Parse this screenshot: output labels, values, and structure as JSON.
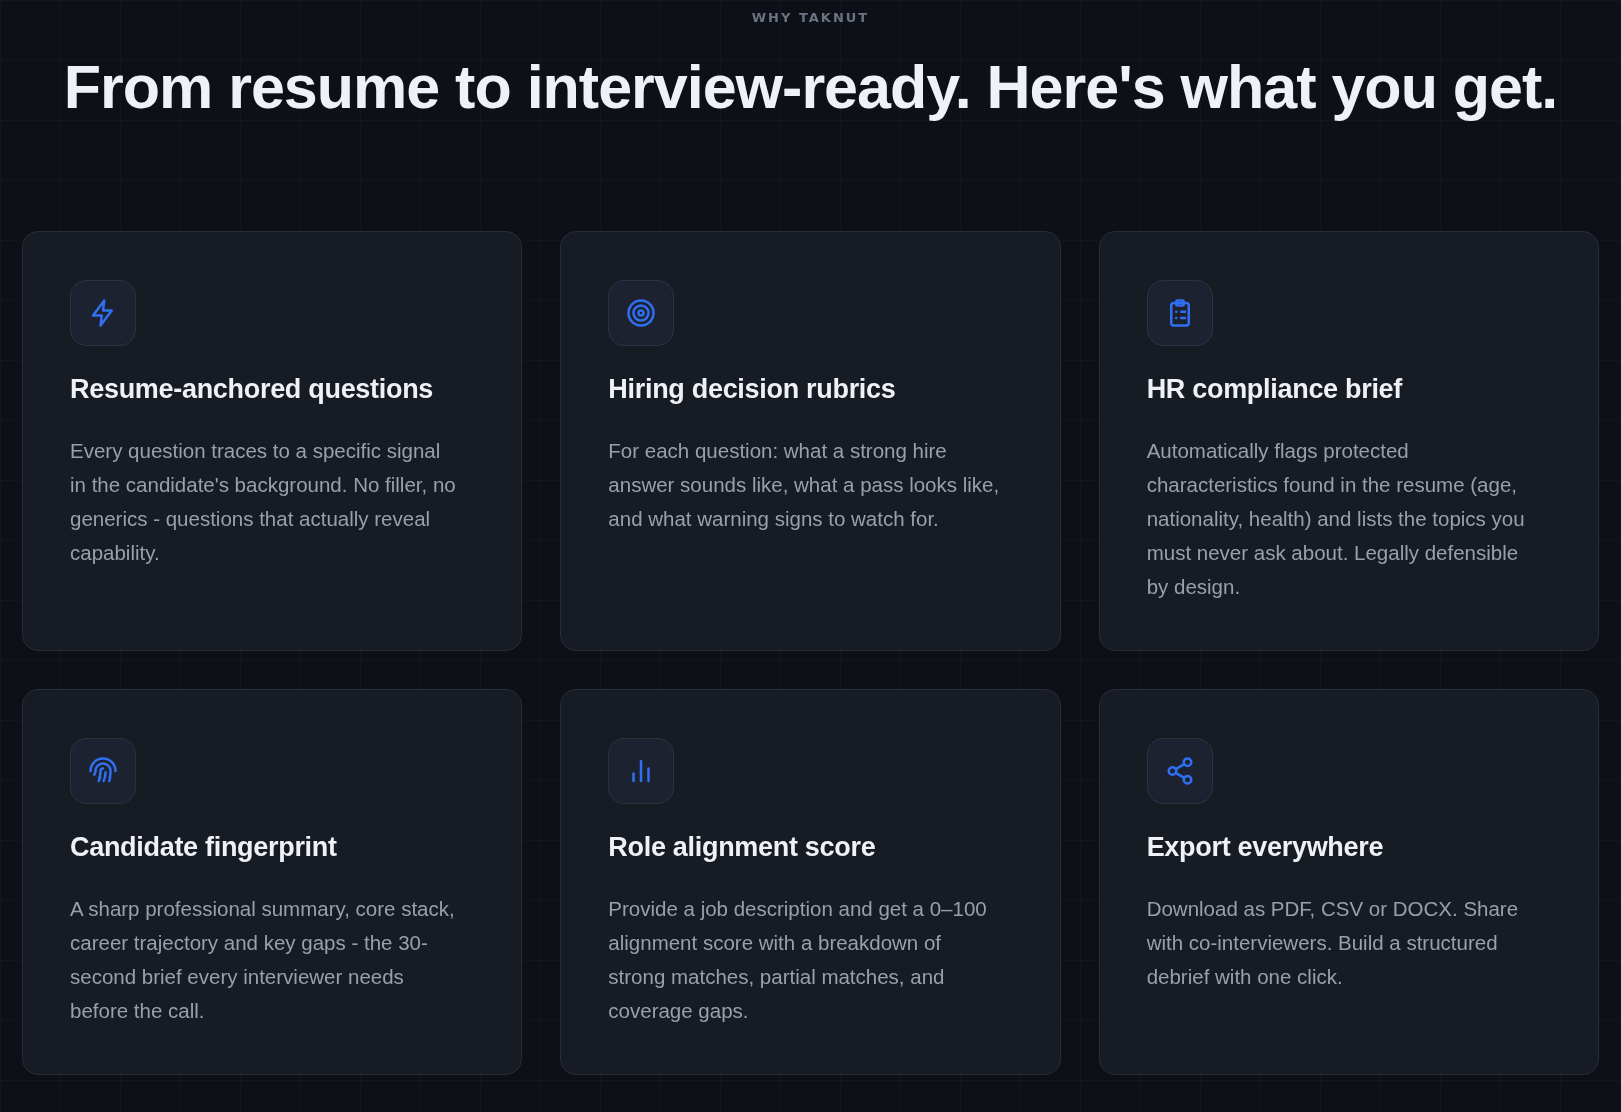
{
  "eyebrow": "WHY TAKNUT",
  "heading": "From resume to interview-ready. Here's what you get.",
  "features": [
    {
      "title": "Resume-anchored questions",
      "body": "Every question traces to a specific signal in the candidate's background. No filler, no generics - questions that actually reveal capability."
    },
    {
      "title": "Hiring decision rubrics",
      "body": "For each question: what a strong hire answer sounds like, what a pass looks like, and what warning signs to watch for."
    },
    {
      "title": "HR compliance brief",
      "body": "Automatically flags protected characteristics found in the resume (age, nationality, health) and lists the topics you must never ask about. Legally defensible by design."
    },
    {
      "title": "Candidate fingerprint",
      "body": "A sharp professional summary, core stack, career trajectory and key gaps - the 30-second brief every interviewer needs before the call."
    },
    {
      "title": "Role alignment score",
      "body": "Provide a job description and get a 0–100 alignment score with a breakdown of strong matches, partial matches, and coverage gaps."
    },
    {
      "title": "Export everywhere",
      "body": "Download as PDF, CSV or DOCX. Share with co-interviewers. Build a structured debrief with one click."
    }
  ]
}
